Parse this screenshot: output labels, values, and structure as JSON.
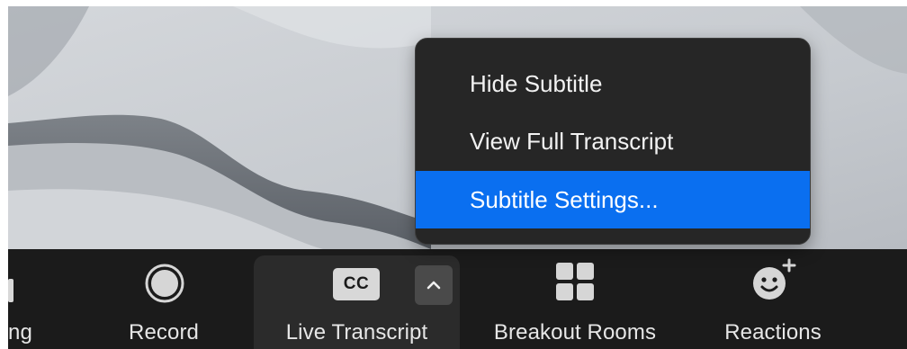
{
  "context_menu": {
    "items": [
      {
        "label": "Hide Subtitle"
      },
      {
        "label": "View Full Transcript"
      },
      {
        "label": "Subtitle Settings..."
      }
    ],
    "selected_index": 2
  },
  "toolbar": {
    "items": [
      {
        "label": "ng",
        "icon": "partial-icon"
      },
      {
        "label": "Record",
        "icon": "record-icon"
      },
      {
        "label": "Live Transcript",
        "icon": "cc-icon",
        "icon_text": "CC",
        "active": true
      },
      {
        "label": "Breakout Rooms",
        "icon": "breakout-rooms-icon"
      },
      {
        "label": "Reactions",
        "icon": "reactions-icon"
      }
    ]
  },
  "colors": {
    "toolbar_bg": "#1b1b1b",
    "menu_bg": "#262626",
    "menu_highlight": "#0a6ff0",
    "text": "#e6e6e6"
  }
}
